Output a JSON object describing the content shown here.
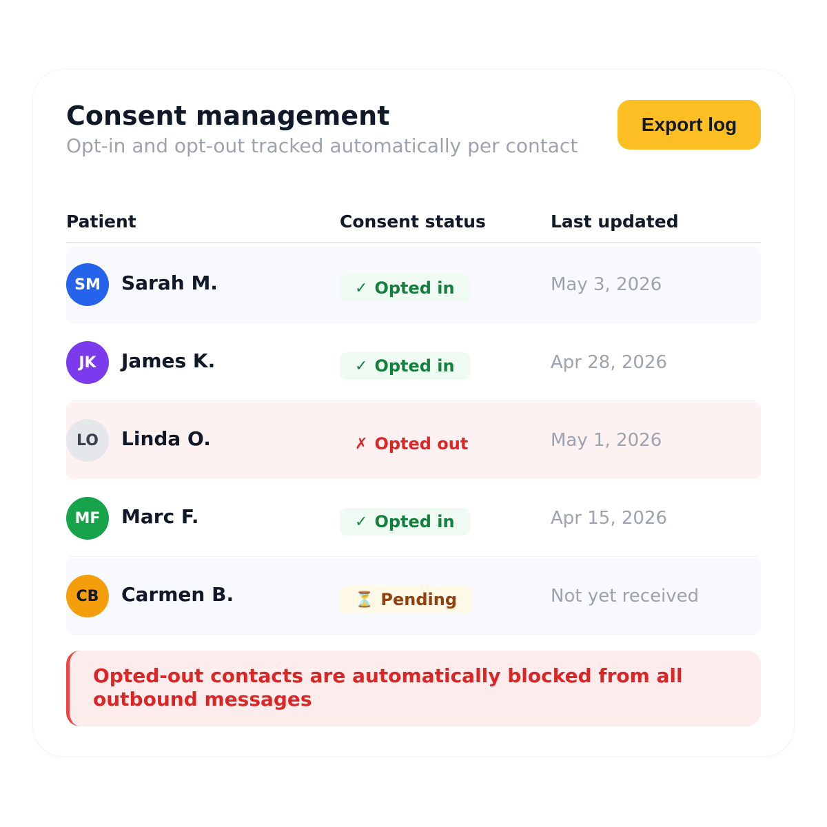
{
  "header": {
    "title": "Consent management",
    "subtitle": "Opt-in and opt-out tracked automatically per contact",
    "export_label": "Export log"
  },
  "table": {
    "columns": [
      "Patient",
      "Consent status",
      "Last updated"
    ],
    "rows": [
      {
        "initials": "SM",
        "name": "Sarah M.",
        "status": "Opted in",
        "status_icon": "✓",
        "updated": "May 3, 2026",
        "avatar_color": "#2563eb"
      },
      {
        "initials": "JK",
        "name": "James K.",
        "status": "Opted in",
        "status_icon": "✓",
        "updated": "Apr 28, 2026",
        "avatar_color": "#7c3aed"
      },
      {
        "initials": "LO",
        "name": "Linda O.",
        "status": "Opted out",
        "status_icon": "✗",
        "updated": "May 1, 2026",
        "avatar_color": "#e5e7eb"
      },
      {
        "initials": "MF",
        "name": "Marc F.",
        "status": "Opted in",
        "status_icon": "✓",
        "updated": "Apr 15, 2026",
        "avatar_color": "#16a34a"
      },
      {
        "initials": "CB",
        "name": "Carmen B.",
        "status": "Pending",
        "status_icon": "⏳",
        "updated": "Not yet received",
        "avatar_color": "#f59e0b"
      }
    ]
  },
  "notice": {
    "text": "Opted-out contacts are automatically blocked from all outbound messages"
  },
  "colors": {
    "accent": "#fbbf24",
    "opted_in": "#15803d",
    "opted_out": "#dc2626",
    "pending": "#92400e"
  }
}
